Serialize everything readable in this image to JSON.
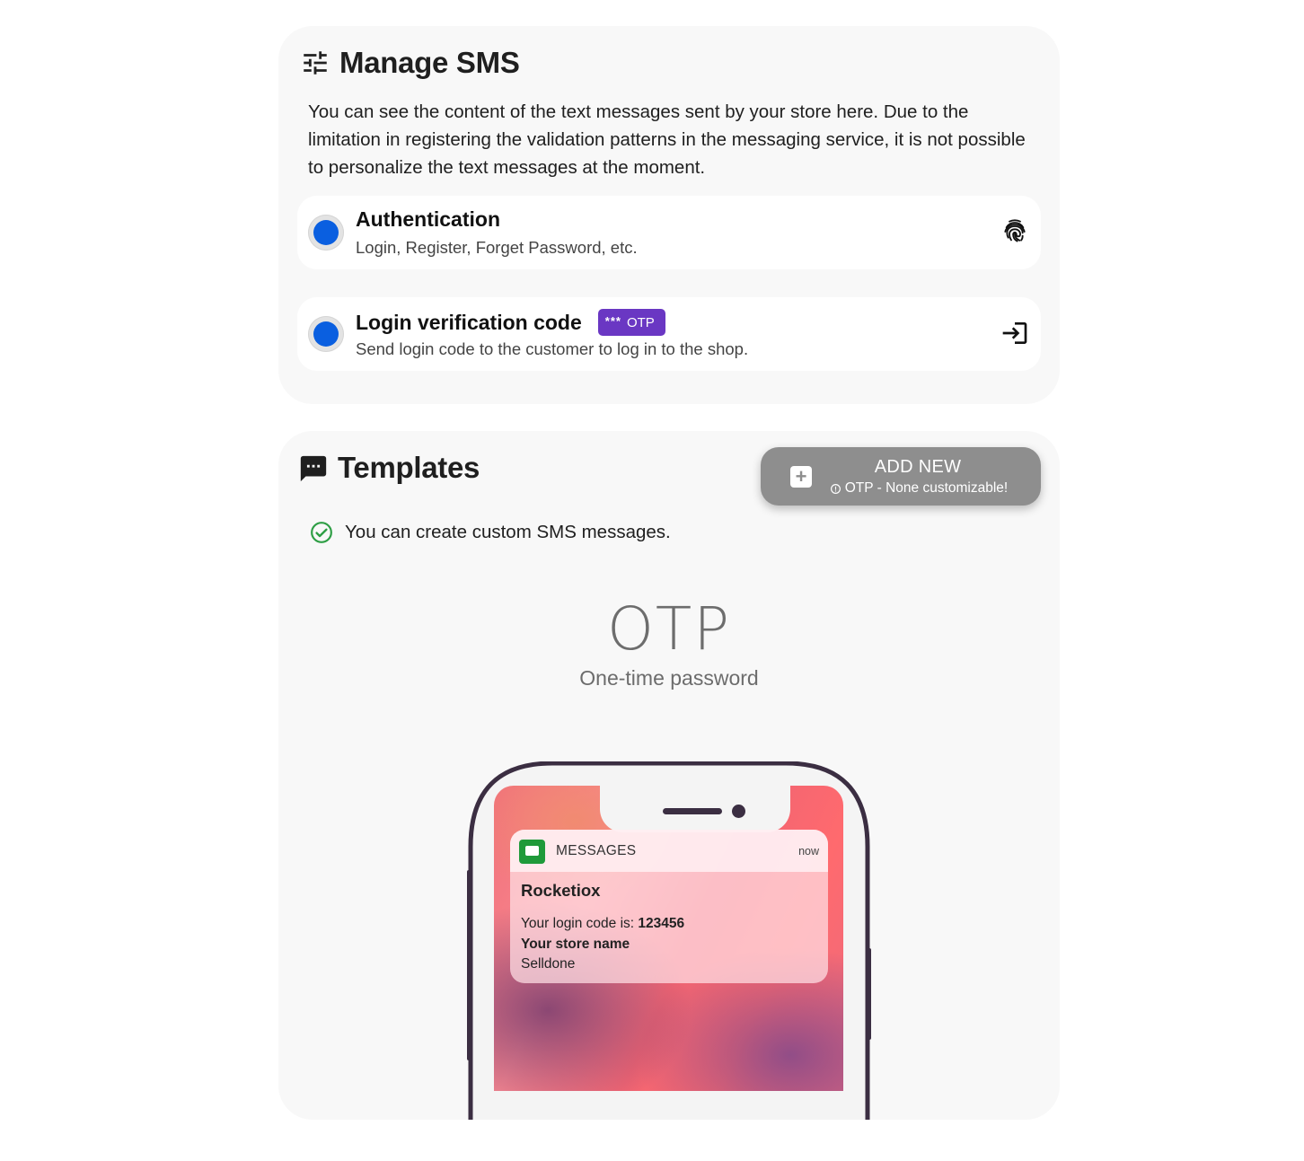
{
  "manage": {
    "title": "Manage SMS",
    "description": "You can see the content of the text messages sent by your store here. Due to the limitation in registering the validation patterns in the messaging service, it is not possible to personalize the text messages at the moment.",
    "items": [
      {
        "title": "Authentication",
        "subtitle": "Login, Register, Forget Password, etc.",
        "icon": "fingerprint-icon"
      },
      {
        "title": "Login verification code",
        "badge": "OTP",
        "badge_stars": "***",
        "subtitle": "Send login code to the customer to log in to the shop.",
        "icon": "login-icon"
      }
    ]
  },
  "templates": {
    "title": "Templates",
    "add_new": {
      "label": "ADD NEW",
      "note": "OTP - None customizable!"
    },
    "custom_note": "You can create custom SMS messages.",
    "preview": {
      "heading": "OTP",
      "subheading": "One-time password",
      "notification": {
        "app_name": "MESSAGES",
        "time": "now",
        "sender": "Rocketiox",
        "line1_prefix": "Your login code is: ",
        "line1_code": "123456",
        "line2": "Your store name",
        "line3": "Selldone"
      }
    }
  },
  "colors": {
    "accent_blue": "#0a5fe0",
    "otp_badge": "#6a37c3",
    "success_green": "#2e9e45",
    "add_button": "#8e8e8e"
  }
}
